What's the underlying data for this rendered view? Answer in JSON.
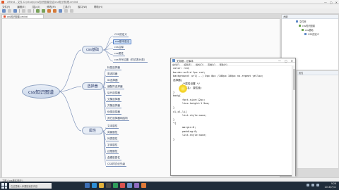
{
  "window": {
    "title": "XMind - 文件 D:/study/css知识图谱总结/css知识梳理.xmind",
    "controls": {
      "minimize": "—",
      "maximize": "▢",
      "close": "✕"
    }
  },
  "menubar": [
    "文件(F)",
    "编辑(E)",
    "插入(I)",
    "修改(M)",
    "工具(T)",
    "窗口(W)",
    "帮助(H)"
  ],
  "doc_tab": {
    "label": "css知识图谱.xmind"
  },
  "mindmap": {
    "root": "css知识图谱",
    "branches": [
      {
        "label": "css基础",
        "leaves": [
          "CSS的定义",
          "css基本语法",
          "css注释",
          "css属性",
          "css书写位置（样式表分类）"
        ],
        "selected": 1
      },
      {
        "label": "选择器",
        "leaves": [
          "标签选择器",
          "类选择器",
          "ID选择器",
          "通配符选择器",
          "后代选择器",
          "交集选择器",
          "并集选择器",
          "伪类选择器",
          "其它选择器和结构"
        ]
      },
      {
        "label": "属性",
        "leaves": [
          "文本属性",
          "背景属性",
          "列表属性",
          "字体属性",
          "边框属性",
          "盒模型属性",
          "CSS样式优先级"
        ]
      }
    ]
  },
  "notepad": {
    "title": "无标题 - 记事本",
    "menu": [
      "文件(F)",
      "编辑(E)",
      "格式(O)",
      "查看(V)",
      "帮助(H)"
    ],
    "lines": [
      "color: red;",
      "border:solid 1px red;",
      "",
      "background: url(...) 0px 0px /100px 100px no-repeat yellow;",
      "",
      "",
      "",
      "选择器{",
      "      /*属性设置.*/",
      "      属性名: 属性值;",
      "}",
      "",
      "",
      "body{",
      "      font-size:12px;",
      "      line-height:1.5em;",
      "}",
      "ul,ol,li{",
      "      list-style:none;",
      "}",
      "*{",
      "      margin:0;",
      "      padding:0;",
      "      list-style:none;",
      "}"
    ]
  },
  "sidebar": {
    "header": "大纲",
    "items": [
      "文件夹",
      "css知识图谱",
      "css基础",
      "CSS的定义"
    ]
  },
  "sidebar2": {
    "header": "属性"
  },
  "statusbar": {
    "text": "主题 ('css基本语法')"
  },
  "badge": {
    "text": "S"
  },
  "taskbar": {
    "search_placeholder": "在这里输入你要搜索的内容",
    "time": "9:26",
    "date": "2018/7/11"
  },
  "colors": {
    "accent": "#4f7bc4",
    "root_fill": "#c9d6ea",
    "taskbar": "#1f2c3a",
    "badge": "#e24b26"
  }
}
